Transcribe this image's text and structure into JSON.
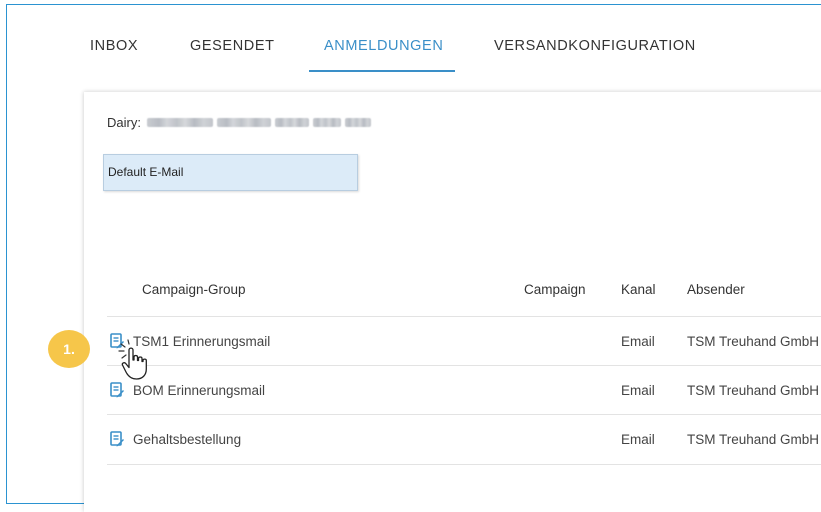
{
  "tabs": [
    {
      "label": "INBOX"
    },
    {
      "label": "GESENDET"
    },
    {
      "label": "ANMELDUNGEN",
      "active": true
    },
    {
      "label": "VERSANDKONFIGURATION"
    }
  ],
  "dairy": {
    "label": "Dairy:"
  },
  "email_select": {
    "value": "Default E-Mail"
  },
  "table": {
    "headers": [
      "Campaign-Group",
      "Campaign",
      "Kanal",
      "Absender"
    ],
    "rows": [
      {
        "campaign_group": "TSM1 Erinnerungsmail",
        "campaign": "",
        "kanal": "Email",
        "absender": "TSM Treuhand GmbH",
        "icon": "edit-document-icon"
      },
      {
        "campaign_group": "BOM Erinnerungsmail",
        "campaign": "",
        "kanal": "Email",
        "absender": "TSM Treuhand GmbH",
        "icon": "edit-document-icon"
      },
      {
        "campaign_group": "Gehaltsbestellung",
        "campaign": "",
        "kanal": "Email",
        "absender": "TSM Treuhand GmbH",
        "icon": "edit-document-icon"
      }
    ]
  },
  "annotation": {
    "step_label": "1.",
    "cursor": "hand-pointer-icon"
  },
  "colors": {
    "accent": "#3a8fc8",
    "frame_border": "#2b93d1",
    "select_bg": "#dcebf8",
    "badge": "#f6c64a"
  }
}
